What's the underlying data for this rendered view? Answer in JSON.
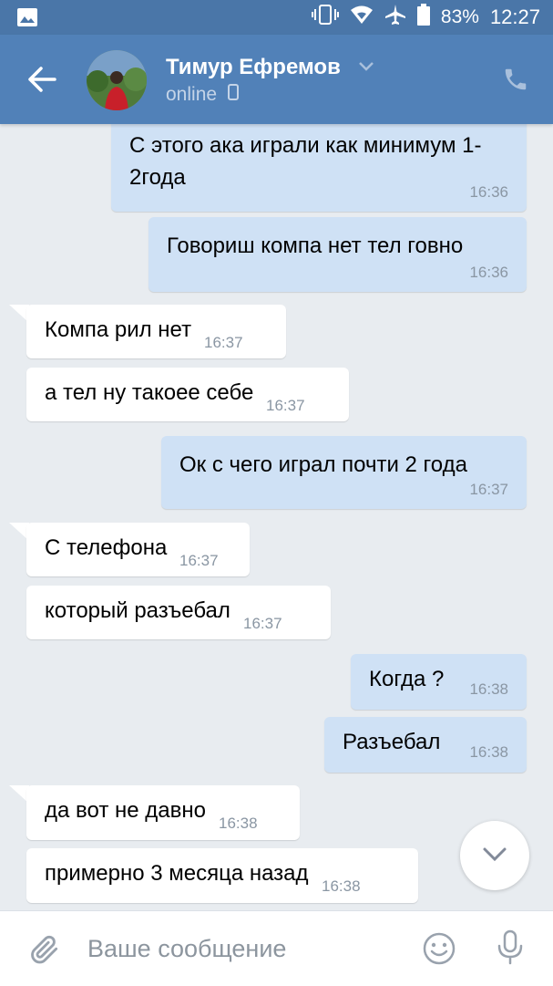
{
  "statusbar": {
    "battery": "83%",
    "time": "12:27"
  },
  "header": {
    "name": "Тимур Ефремов",
    "status": "online"
  },
  "messages": [
    {
      "dir": "out",
      "text": "С этого ака играли как минимум 1-2года",
      "time": "16:36"
    },
    {
      "dir": "out",
      "text": "Говориш компа нет тел говно",
      "time": "16:36"
    },
    {
      "dir": "in",
      "text": "Компа рил нет",
      "time": "16:37"
    },
    {
      "dir": "in",
      "text": "а тел ну такоее себе",
      "time": "16:37"
    },
    {
      "dir": "out",
      "text": "Ок с чего играл почти 2 года",
      "time": "16:37"
    },
    {
      "dir": "in",
      "text": "С телефона",
      "time": "16:37"
    },
    {
      "dir": "in",
      "text": "который разъебал",
      "time": "16:37"
    },
    {
      "dir": "out",
      "text": "Когда ?",
      "time": "16:38"
    },
    {
      "dir": "out",
      "text": "Разъебал",
      "time": "16:38"
    },
    {
      "dir": "in",
      "text": "да вот не давно",
      "time": "16:38"
    },
    {
      "dir": "in",
      "text": "примерно 3 месяца назад",
      "time": "16:38"
    }
  ],
  "input": {
    "placeholder": "Ваше сообщение"
  },
  "colors": {
    "header": "#5181b8",
    "statusbar": "#4a76a8",
    "bubble_out": "#cfe1f5",
    "bubble_in": "#ffffff",
    "background": "#e8ecf0"
  }
}
